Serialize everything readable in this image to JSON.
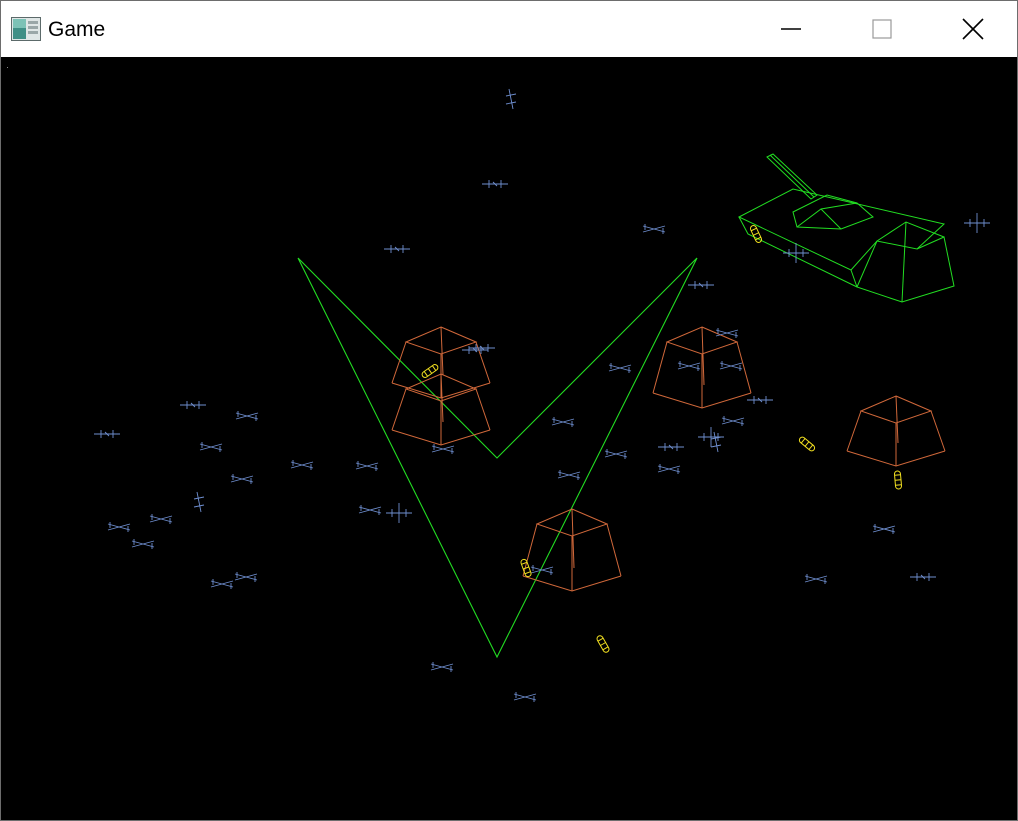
{
  "window": {
    "title": "Game",
    "icon": "application-window-icon",
    "controls": [
      "minimize-icon",
      "maximize-icon",
      "close-icon"
    ]
  },
  "scene": {
    "background_color": "#000000",
    "colors": {
      "chevron": "#22dd22",
      "tank": "#22dd22",
      "crate": "#d0683a",
      "enemy": "#6f8fd0",
      "projectile": "#f2e020"
    },
    "crate_count": 5,
    "projectile_count": 6,
    "enemy_count": 61
  }
}
